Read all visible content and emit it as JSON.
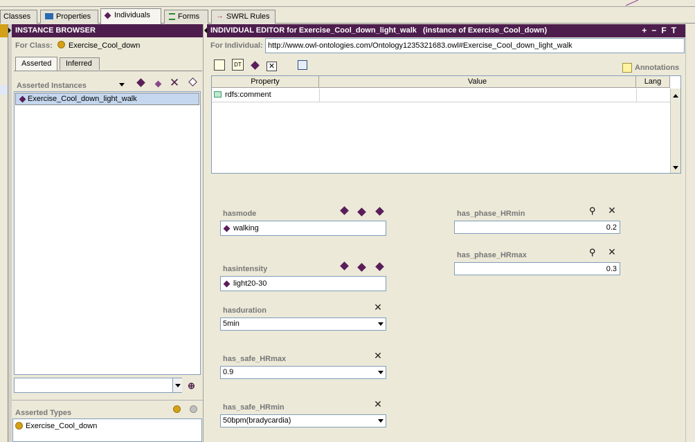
{
  "tabs": [
    {
      "label": "Classes",
      "icon": "classes-icon"
    },
    {
      "label": "Properties",
      "icon": "properties-icon"
    },
    {
      "label": "Individuals",
      "icon": "individuals-icon"
    },
    {
      "label": "Forms",
      "icon": "forms-icon"
    },
    {
      "label": "SWRL Rules",
      "icon": "swrl-icon"
    }
  ],
  "instance_browser": {
    "title": "INSTANCE BROWSER",
    "for_class_label": "For Class:",
    "for_class_value": "Exercise_Cool_down",
    "subtab_asserted": "Asserted",
    "subtab_inferred": "Inferred",
    "asserted_instances_label": "Asserted Instances",
    "instances": [
      "Exercise_Cool_down_light_walk"
    ],
    "search_value": "",
    "asserted_types_label": "Asserted Types",
    "types": [
      "Exercise_Cool_down"
    ]
  },
  "individual_editor": {
    "title": "INDIVIDUAL EDITOR for Exercise_Cool_down_light_walk   (instance of Exercise_Cool_down)",
    "header_buttons": [
      "+",
      "−",
      "F",
      "T"
    ],
    "for_individual_label": "For Individual:",
    "for_individual_value": "http://www.owl-ontologies.com/Ontology1235321683.owl#Exercise_Cool_down_light_walk",
    "annotations_label": "Annotations",
    "table_headers": {
      "property": "Property",
      "value": "Value",
      "lang": "Lang"
    },
    "table_rows": [
      {
        "property": "rdfs:comment",
        "value": "",
        "lang": ""
      }
    ]
  },
  "properties": {
    "hasmode": {
      "label": "hasmode",
      "value": "walking"
    },
    "hasintensity": {
      "label": "hasintensity",
      "value": "light20-30"
    },
    "hasduration": {
      "label": "hasduration",
      "value": "5min"
    },
    "has_safe_HRmax": {
      "label": "has_safe_HRmax",
      "value": "0.9"
    },
    "has_safe_HRmin": {
      "label": "has_safe_HRmin",
      "value": "50bpm(bradycardia)"
    },
    "has_phase_HRmin": {
      "label": "has_phase_HRmin",
      "value": "0.2"
    },
    "has_phase_HRmax": {
      "label": "has_phase_HRmax",
      "value": "0.3"
    }
  }
}
